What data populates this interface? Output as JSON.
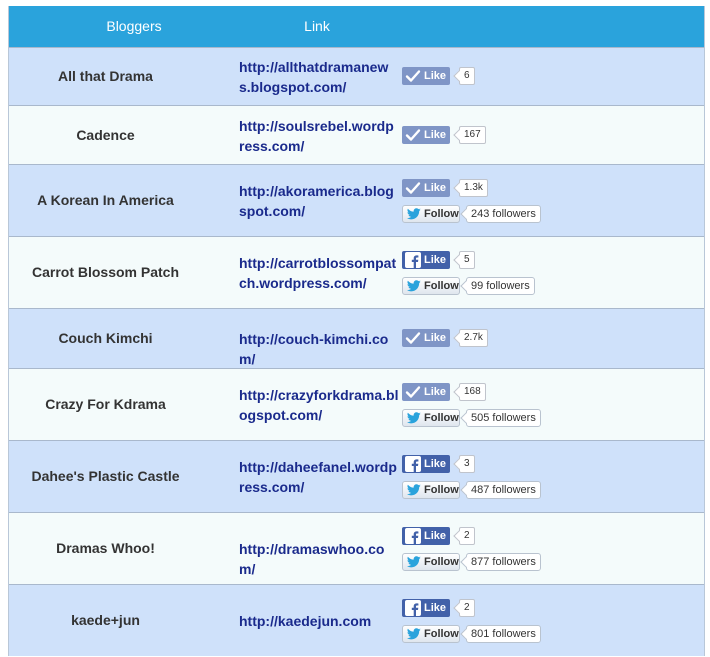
{
  "header": {
    "col_bloggers": "Bloggers",
    "col_link": "Link"
  },
  "rows": [
    {
      "name": "All that Drama",
      "link": "http://allthatdramanews.blogspot.com/",
      "like_style": "gray",
      "like_label": "Like",
      "like_count": "6"
    },
    {
      "name": "Cadence",
      "link": "http://soulsrebel.wordpress.com/",
      "like_style": "gray",
      "like_label": "Like",
      "like_count": "167"
    },
    {
      "name": "A Korean In America",
      "link": "http://akoramerica.blogspot.com/",
      "like_style": "gray",
      "like_label": "Like",
      "like_count": "1.3k",
      "follow_label": "Follow",
      "followers": "243 followers"
    },
    {
      "name": "Carrot Blossom Patch",
      "link": "http://carrotblossompatch.wordpress.com/",
      "like_style": "fb",
      "like_label": "Like",
      "like_count": "5",
      "follow_label": "Follow",
      "followers": "99 followers"
    },
    {
      "name": "Couch Kimchi",
      "link": "http://couch-kimchi.com/",
      "like_style": "gray",
      "like_label": "Like",
      "like_count": "2.7k"
    },
    {
      "name": "Crazy For Kdrama",
      "link": "http://crazyforkdrama.blogspot.com/",
      "like_style": "gray",
      "like_label": "Like",
      "like_count": "168",
      "follow_label": "Follow",
      "followers": "505 followers"
    },
    {
      "name": "Dahee's Plastic Castle",
      "link": "http://daheefanel.wordpress.com/",
      "like_style": "fb",
      "like_label": "Like",
      "like_count": "3",
      "follow_label": "Follow",
      "followers": "487 followers"
    },
    {
      "name": "Dramas Whoo!",
      "link": "http://dramaswhoo.com/",
      "like_style": "fb",
      "like_label": "Like",
      "like_count": "2",
      "follow_label": "Follow",
      "followers": "877 followers"
    },
    {
      "name": "kaede+jun",
      "link": "http://kaedejun.com",
      "like_style": "fb",
      "like_label": "Like",
      "like_count": "2",
      "follow_label": "Follow",
      "followers": "801 followers"
    }
  ],
  "colors": {
    "header_bg": "#2aa3dc",
    "row_blue": "#cfe1fa",
    "row_white": "#f4fbfb",
    "link": "#1a2a8c",
    "fb_like": "#4261a9",
    "gray_like": "#7f95c6",
    "twitter_bird": "#2aa3dc"
  },
  "icons": {
    "gray_like": "checkmark-icon",
    "fb_like": "facebook-f-icon",
    "follow": "twitter-bird-icon"
  }
}
